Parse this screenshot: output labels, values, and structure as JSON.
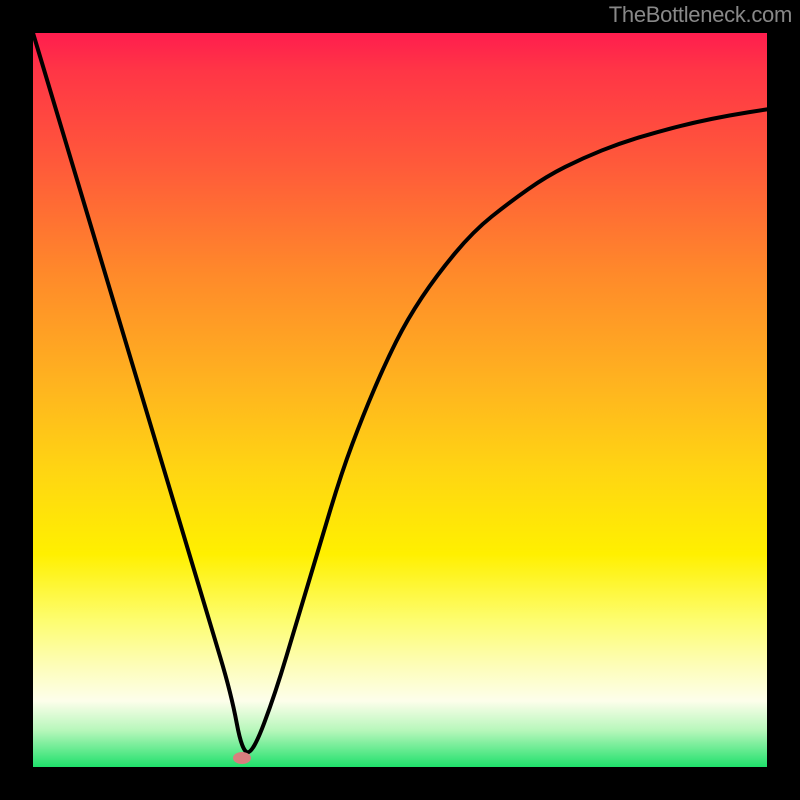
{
  "watermark": "TheBottleneck.com",
  "chart_data": {
    "type": "line",
    "title": "",
    "xlabel": "",
    "ylabel": "",
    "xlim": [
      0,
      100
    ],
    "ylim": [
      0,
      100
    ],
    "grid": false,
    "legend": false,
    "background": "gradient-red-to-green",
    "series": [
      {
        "name": "curve",
        "color": "#000000",
        "x": [
          0,
          3,
          6,
          9,
          12,
          15,
          18,
          21,
          24,
          27,
          28.5,
          30,
          33,
          36,
          39,
          42,
          45,
          48,
          51,
          55,
          60,
          65,
          70,
          75,
          80,
          85,
          90,
          95,
          100
        ],
        "y": [
          100,
          90,
          80,
          70,
          60,
          50,
          40,
          30,
          20,
          10,
          2,
          2,
          10,
          20,
          30,
          40,
          48,
          55,
          61,
          67,
          73,
          77,
          80.5,
          83,
          85,
          86.5,
          87.8,
          88.8,
          89.6
        ]
      }
    ],
    "markers": [
      {
        "name": "minimum",
        "x": 28.5,
        "y": 1.2,
        "color": "#d97e7e"
      }
    ]
  }
}
